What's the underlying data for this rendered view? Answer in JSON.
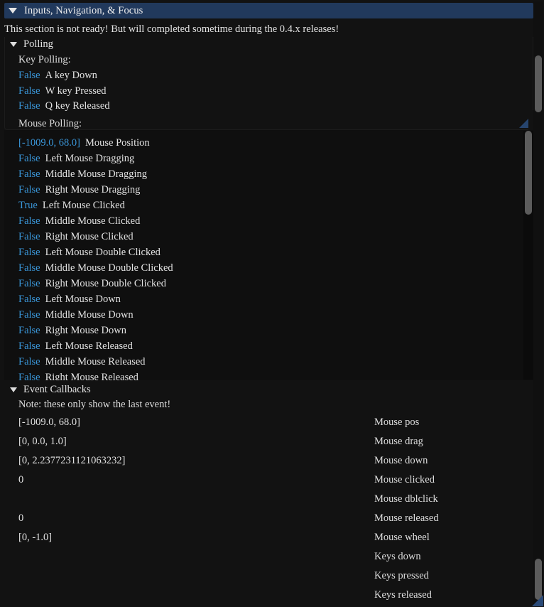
{
  "window": {
    "section_title": "Inputs, Navigation, & Focus",
    "collapse_icon": "triangle-down-icon",
    "notice": "This section is not ready! But will completed sometime during the 0.4.x releases!"
  },
  "polling": {
    "node_label": "Polling",
    "key_polling_label": "Key Polling:",
    "key_rows": [
      {
        "value": "False",
        "desc": "A key Down"
      },
      {
        "value": "False",
        "desc": "W key Pressed"
      },
      {
        "value": "False",
        "desc": "Q key Released"
      }
    ],
    "mouse_polling_label": "Mouse Polling:",
    "mouse_rows": [
      {
        "value": "[-1009.0, 68.0]",
        "desc": "Mouse Position"
      },
      {
        "value": "False",
        "desc": "Left Mouse Dragging"
      },
      {
        "value": "False",
        "desc": "Middle Mouse Dragging"
      },
      {
        "value": "False",
        "desc": "Right Mouse Dragging"
      },
      {
        "value": "True",
        "desc": "Left Mouse Clicked"
      },
      {
        "value": "False",
        "desc": "Middle Mouse Clicked"
      },
      {
        "value": "False",
        "desc": "Right Mouse Clicked"
      },
      {
        "value": "False",
        "desc": "Left Mouse Double Clicked"
      },
      {
        "value": "False",
        "desc": "Middle Mouse Double Clicked"
      },
      {
        "value": "False",
        "desc": "Right Mouse Double Clicked"
      },
      {
        "value": "False",
        "desc": "Left Mouse Down"
      },
      {
        "value": "False",
        "desc": "Middle Mouse Down"
      },
      {
        "value": "False",
        "desc": "Right Mouse Down"
      },
      {
        "value": "False",
        "desc": "Left Mouse Released"
      },
      {
        "value": "False",
        "desc": "Middle Mouse Released"
      },
      {
        "value": "False",
        "desc": "Right Mouse Released"
      }
    ]
  },
  "event_callbacks": {
    "node_label": "Event Callbacks",
    "note": "Note: these only show the last event!",
    "rows": [
      {
        "value": "[-1009.0, 68.0]",
        "label": "Mouse pos"
      },
      {
        "value": "[0, 0.0, 1.0]",
        "label": "Mouse drag"
      },
      {
        "value": "[0, 2.2377231121063232]",
        "label": "Mouse down"
      },
      {
        "value": "0",
        "label": "Mouse clicked"
      },
      {
        "value": "",
        "label": "Mouse dblclick"
      },
      {
        "value": "0",
        "label": "Mouse released"
      },
      {
        "value": "[0, -1.0]",
        "label": "Mouse wheel"
      },
      {
        "value": "",
        "label": "Keys down"
      },
      {
        "value": "",
        "label": "Keys pressed"
      },
      {
        "value": "",
        "label": "Keys released"
      }
    ]
  },
  "scrollbars": {
    "outer": {
      "name": "outer-vertical-scrollbar"
    },
    "inner": {
      "name": "inner-vertical-scrollbar"
    }
  },
  "colors": {
    "header_bg": "#21395c",
    "value_blue": "#3a96d8",
    "text": "#e3e3e3",
    "background": "#121212",
    "grip": "#2a4a78"
  }
}
